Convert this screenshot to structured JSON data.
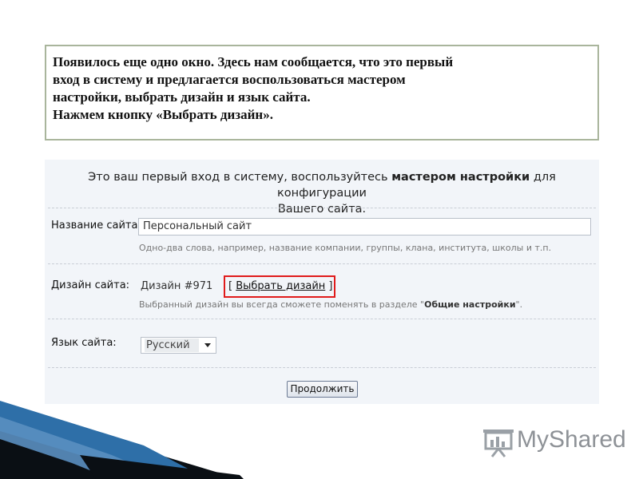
{
  "note": {
    "lines": [
      "Появилось еще одно окно. Здесь нам сообщается, что это первый",
      "вход в систему и предлагается воспользоваться мастером",
      "настройки, выбрать дизайн и язык сайта.",
      "Нажмем кнопку «Выбрать дизайн»."
    ]
  },
  "panel": {
    "intro": {
      "part1": "Это ваш первый вход в систему, воспользуйтесь ",
      "bold": "мастером настройки",
      "part2": " для конфигурации",
      "line2": "Вашего сайта."
    },
    "site_name": {
      "label": "Название сайта:",
      "value": "Персональный сайт",
      "hint": "Одно-два слова, например, название компании, группы, клана, института, школы и т.п."
    },
    "design": {
      "label": "Дизайн сайта:",
      "value": "Дизайн #971",
      "bracket_open": "[ ",
      "link": "Выбрать дизайн",
      "bracket_close": " ]",
      "hint_pre": "Выбранный дизайн вы всегда сможете поменять в разделе \"",
      "hint_bold": "Общие настройки",
      "hint_post": "\"."
    },
    "language": {
      "label": "Язык сайта:",
      "value": "Русский"
    },
    "continue_label": "Продолжить"
  },
  "logo": {
    "text": "MyShared",
    "icon": "presentation-board-icon"
  },
  "colors": {
    "highlight": "#e01b1b",
    "note_border": "#a9b59c",
    "panel_bg": "#f2f5f9",
    "deco_dark": "#0a0f14",
    "deco_blue": "#2e6fa8"
  }
}
